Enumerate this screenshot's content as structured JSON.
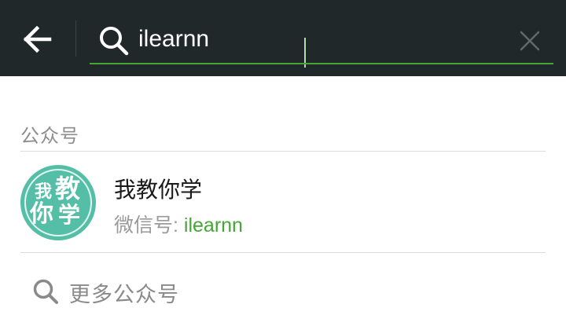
{
  "header": {
    "back_icon": "arrow-left-icon",
    "search_icon": "search-icon",
    "search_value": "ilearnn",
    "clear_icon": "close-icon",
    "accent_color": "#45a635",
    "background_color": "#21282a"
  },
  "section": {
    "label": "公众号"
  },
  "results": [
    {
      "avatar_chars": [
        "我",
        "教",
        "你",
        "学"
      ],
      "name": "我教你学",
      "id_label": "微信号: ",
      "id_value": "ilearnn"
    }
  ],
  "more": {
    "icon": "search-icon",
    "label": "更多公众号"
  }
}
